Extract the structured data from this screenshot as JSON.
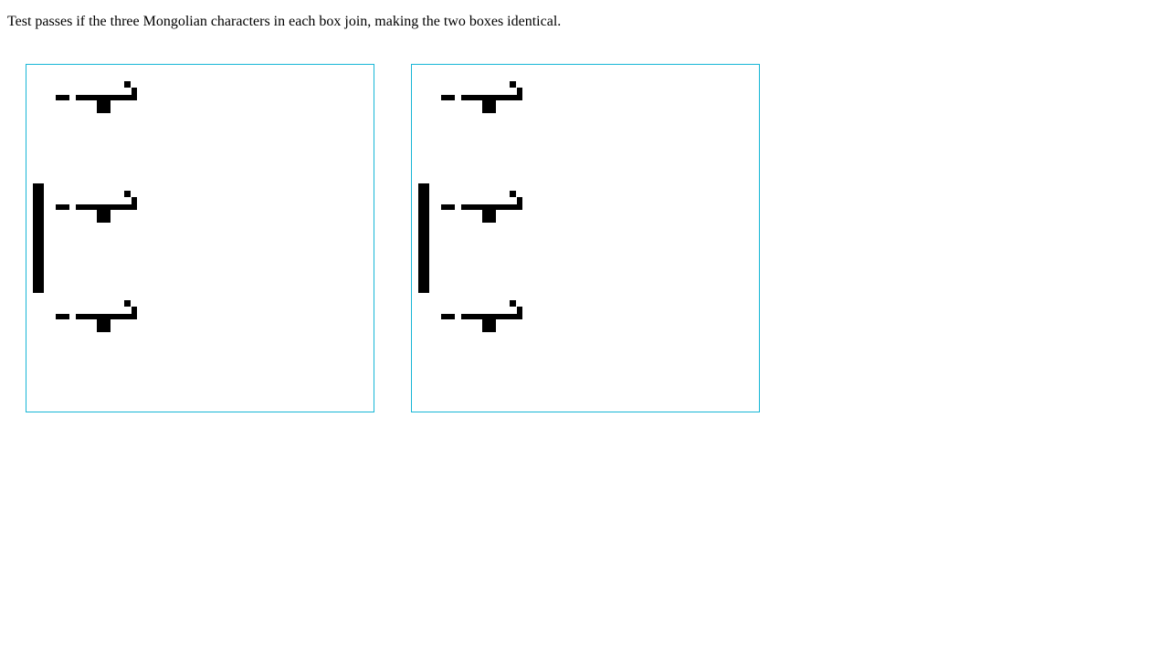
{
  "page": {
    "instruction": "Test passes if the three Mongolian characters in each box join, making the two boxes identical."
  },
  "colors": {
    "box_border": "#16b6d6",
    "glyph": "#000000",
    "background": "#ffffff"
  },
  "boxes": [
    {
      "id": "test",
      "glyph_clusters": 3,
      "has_cursor_bar": true
    },
    {
      "id": "reference",
      "glyph_clusters": 3,
      "has_cursor_bar": true
    }
  ]
}
